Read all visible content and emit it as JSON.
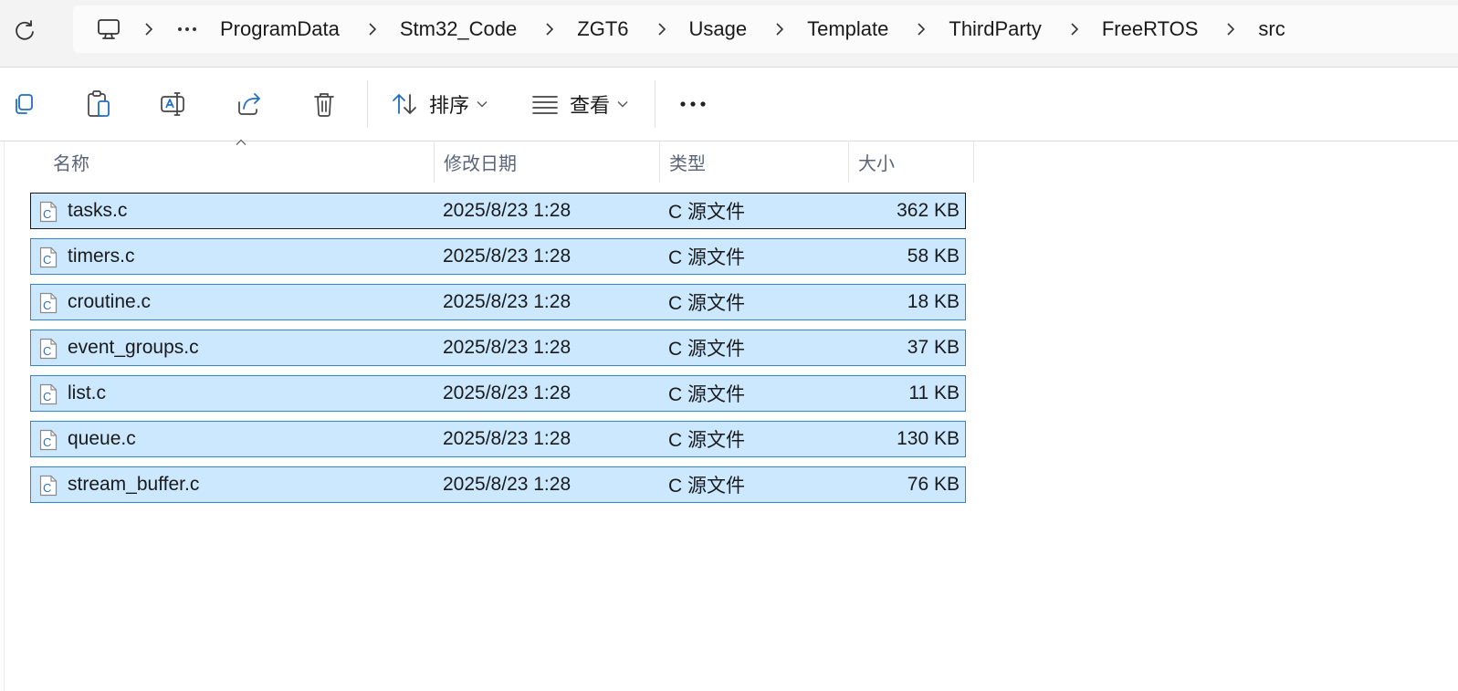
{
  "address_bar": {
    "more_label": "···",
    "breadcrumbs": [
      "ProgramData",
      "Stm32_Code",
      "ZGT6",
      "Usage",
      "Template",
      "ThirdParty",
      "FreeRTOS",
      "src"
    ]
  },
  "toolbar": {
    "sort_label": "排序",
    "view_label": "查看",
    "more_label": "···"
  },
  "columns": {
    "name": "名称",
    "modified": "修改日期",
    "type": "类型",
    "size": "大小"
  },
  "files": [
    {
      "name": "tasks.c",
      "modified": "2025/8/23 1:28",
      "type": "C 源文件",
      "size": "362 KB"
    },
    {
      "name": "timers.c",
      "modified": "2025/8/23 1:28",
      "type": "C 源文件",
      "size": "58 KB"
    },
    {
      "name": "croutine.c",
      "modified": "2025/8/23 1:28",
      "type": "C 源文件",
      "size": "18 KB"
    },
    {
      "name": "event_groups.c",
      "modified": "2025/8/23 1:28",
      "type": "C 源文件",
      "size": "37 KB"
    },
    {
      "name": "list.c",
      "modified": "2025/8/23 1:28",
      "type": "C 源文件",
      "size": "11 KB"
    },
    {
      "name": "queue.c",
      "modified": "2025/8/23 1:28",
      "type": "C 源文件",
      "size": "130 KB"
    },
    {
      "name": "stream_buffer.c",
      "modified": "2025/8/23 1:28",
      "type": "C 源文件",
      "size": "76 KB"
    }
  ],
  "colors": {
    "selection_fill": "#cce8ff",
    "selection_border": "#2f86d8",
    "accent": "#1f6fc5"
  }
}
